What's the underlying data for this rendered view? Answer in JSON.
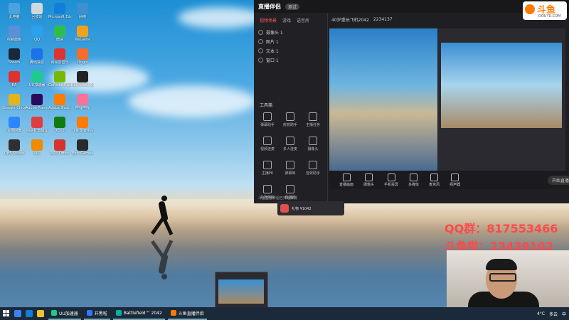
{
  "desktop": {
    "icons": [
      {
        "label": "此电脑",
        "color": "#4aa3df"
      },
      {
        "label": "回收站",
        "color": "#cfd8dc"
      },
      {
        "label": "Microsoft Edge",
        "color": "#0f7fd8"
      },
      {
        "label": "网络",
        "color": "#3e8ed0"
      },
      {
        "label": "控制面板",
        "color": "#5c8fd6"
      },
      {
        "label": "QQ",
        "color": "#2ba0ef"
      },
      {
        "label": "微信",
        "color": "#2bbf4a"
      },
      {
        "label": "WeGame",
        "color": "#f2a21a"
      },
      {
        "label": "Steam",
        "color": "#1b2838"
      },
      {
        "label": "腾讯会议",
        "color": "#1a73e8"
      },
      {
        "label": "网易云音乐",
        "color": "#d33"
      },
      {
        "label": "Origin",
        "color": "#f56c2d"
      },
      {
        "label": "EA",
        "color": "#e03030"
      },
      {
        "label": "UU加速器",
        "color": "#1ecb8a"
      },
      {
        "label": "GeForce Experience",
        "color": "#76b900"
      },
      {
        "label": "Battlefield 2042",
        "color": "#222"
      },
      {
        "label": "Google Chrome",
        "color": "#e7b417"
      },
      {
        "label": "Adobe Premiere",
        "color": "#2b0a5c"
      },
      {
        "label": "Adobe Illustrator",
        "color": "#ff7c00"
      },
      {
        "label": "哔哩哔哩",
        "color": "#fb7299"
      },
      {
        "label": "百度网盘",
        "color": "#2e86ff"
      },
      {
        "label": "网易有道翻译",
        "color": "#e03e3e"
      },
      {
        "label": "Xbox",
        "color": "#107c10"
      },
      {
        "label": "斗鱼直播伴侣",
        "color": "#ff7a00"
      },
      {
        "label": "OBS Studio",
        "color": "#302e31"
      },
      {
        "label": "VLC",
        "color": "#f08a00"
      },
      {
        "label": "WPS Office",
        "color": "#d6322e"
      },
      {
        "label": "Epic Games",
        "color": "#2a2a2a"
      }
    ]
  },
  "app": {
    "logo_text": "直播伴侣",
    "beta": "测试",
    "username": "斗鱼",
    "left_tabs": [
      "视频场景",
      "游戏",
      "语音房"
    ],
    "layers": [
      "摄像头 1",
      "图片 1",
      "文本 1",
      "窗口 1"
    ],
    "room_title": "40岁重玩飞机2042",
    "room_info": "2234137",
    "tools_title": "工具箱",
    "tools": [
      "弹幕助手",
      "房管助手",
      "主播任务",
      "视频连麦",
      "多人连麦",
      "摄像头",
      "主播PK",
      "弹幕库",
      "音效助手",
      "礼物特效",
      "直播间"
    ],
    "bottom_items": [
      "直播画面",
      "摄像头",
      "手机投屏",
      "多媒体",
      "麦克风",
      "扬声器"
    ],
    "start_label": "开始直播",
    "footer_note": "斗鱼直播伴侣已开始推流"
  },
  "douyu": {
    "brand": "斗鱼",
    "sub": "DOUYU.COM"
  },
  "overlay": {
    "qq_text": "QQ群：817553466",
    "dy_text": "斗鱼啦：23439102"
  },
  "gift": {
    "text": "礼物 ¥1042"
  },
  "taskbar": {
    "apps": [
      {
        "label": "UU加速器",
        "color": "#1ecb8a"
      },
      {
        "label": "开黑啦",
        "color": "#3478f6"
      },
      {
        "label": "Battlefield™ 2042",
        "color": "#00b3a1"
      },
      {
        "label": "斗鱼直播伴侣",
        "color": "#ff7a00"
      }
    ],
    "temperature": "4°C",
    "weather": "多云",
    "time": "",
    "lang": "中"
  }
}
